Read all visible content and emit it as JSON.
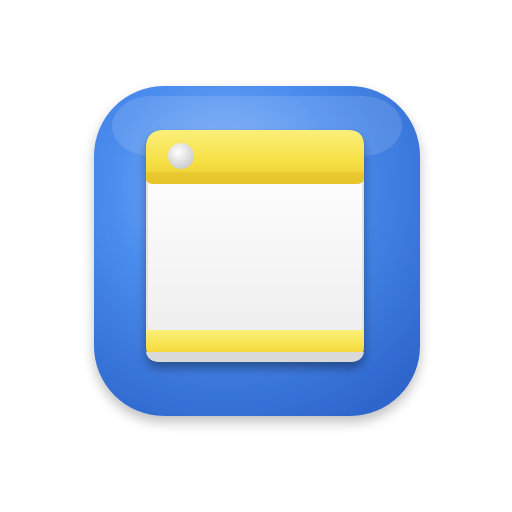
{
  "icon": {
    "name": "window-app-icon",
    "colors": {
      "background": "#ffffff",
      "tile_blue": "#3f86ec",
      "tile_blue_light": "#6aa6f6",
      "tile_blue_dark": "#2a62c8",
      "panel_white": "#fbfbfb",
      "bar_yellow": "#f7e35a",
      "bar_yellow_dark": "#e6c72e",
      "dot_gray": "#d7d7d7"
    }
  }
}
